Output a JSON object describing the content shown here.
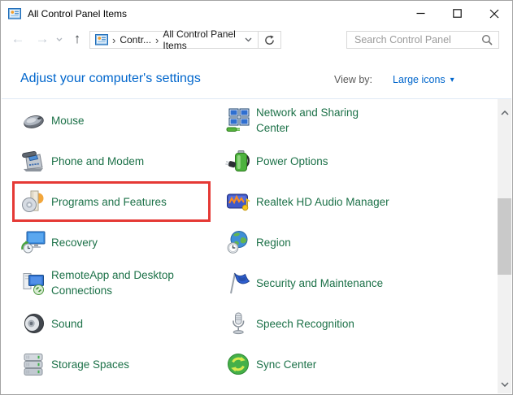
{
  "window": {
    "title": "All Control Panel Items"
  },
  "toolbar": {
    "breadcrumb": {
      "segments": [
        "Contr...",
        "All Control Panel Items"
      ]
    },
    "search": {
      "placeholder": "Search Control Panel"
    }
  },
  "header": {
    "title": "Adjust your computer's settings",
    "view_by_label": "View by:",
    "view_by_value": "Large icons",
    "view_by_caret": "▾"
  },
  "content": {
    "items_left": [
      {
        "label": "Mouse",
        "icon": "mouse-icon"
      },
      {
        "label": "Phone and Modem",
        "icon": "phone-icon"
      },
      {
        "label": "Programs and Features",
        "icon": "programs-and-features-icon",
        "highlighted": true
      },
      {
        "label": "Recovery",
        "icon": "recovery-icon"
      },
      {
        "label": "RemoteApp and Desktop\nConnections",
        "icon": "remoteapp-icon"
      },
      {
        "label": "Sound",
        "icon": "sound-icon"
      },
      {
        "label": "Storage Spaces",
        "icon": "storage-spaces-icon"
      }
    ],
    "items_right": [
      {
        "label": "Network and Sharing\nCenter",
        "icon": "network-sharing-icon"
      },
      {
        "label": "Power Options",
        "icon": "power-options-icon"
      },
      {
        "label": "Realtek HD Audio Manager",
        "icon": "realtek-audio-icon"
      },
      {
        "label": "Region",
        "icon": "region-icon"
      },
      {
        "label": "Security and Maintenance",
        "icon": "security-maintenance-icon"
      },
      {
        "label": "Speech Recognition",
        "icon": "speech-recognition-icon"
      },
      {
        "label": "Sync Center",
        "icon": "sync-center-icon"
      }
    ]
  },
  "colors": {
    "link_blue": "#0066cc",
    "item_text_green": "#1c7148",
    "highlight_red": "#e53935"
  }
}
